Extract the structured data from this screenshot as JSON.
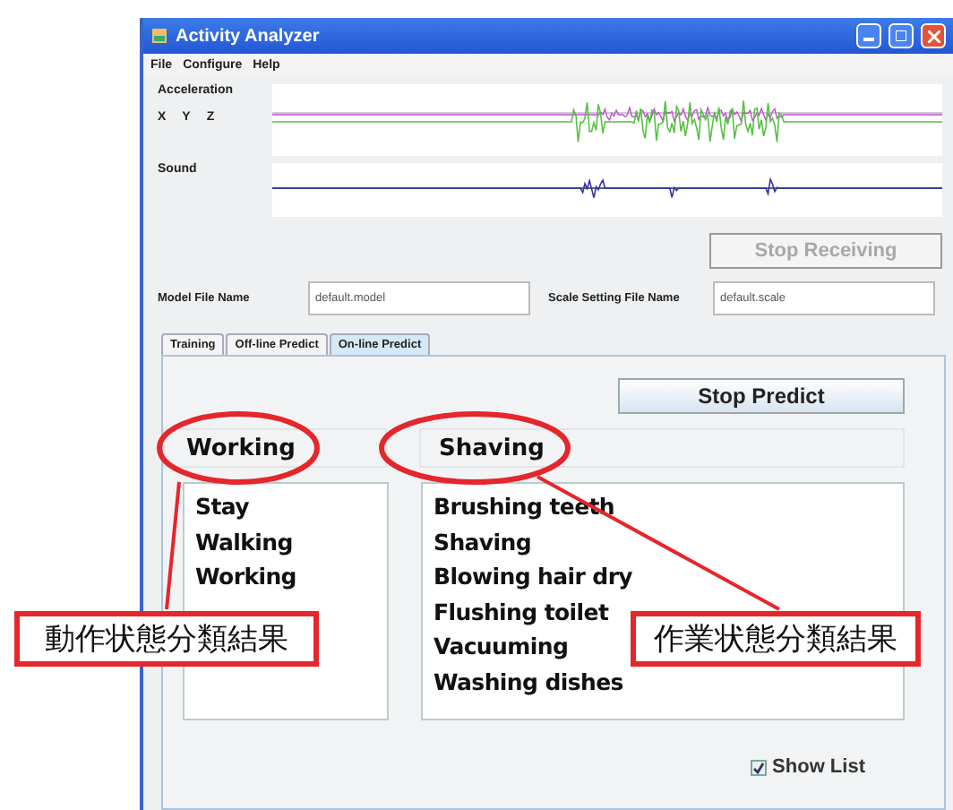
{
  "window": {
    "title": "Activity Analyzer"
  },
  "menu": [
    "File",
    "Configure",
    "Help"
  ],
  "signals": {
    "acceleration_label": "Acceleration",
    "axes": [
      "X",
      "Y",
      "Z"
    ],
    "sound_label": "Sound"
  },
  "stop_receiving": {
    "label": "Stop Receiving",
    "disabled": true
  },
  "files": [
    {
      "label": "Model File Name",
      "value": "default.model"
    },
    {
      "label": "Scale Setting File Name",
      "value": "default.scale"
    }
  ],
  "tabs": [
    {
      "label": "Training",
      "selected": false
    },
    {
      "label": "Off-line Predict",
      "selected": false
    },
    {
      "label": "On-line Predict",
      "selected": true
    }
  ],
  "stop_predict": "Stop Predict",
  "motion": {
    "result": "Working",
    "items": [
      "Stay",
      "Walking",
      "Working"
    ]
  },
  "task": {
    "result": "Shaving",
    "items": [
      "Brushing teeth",
      "Shaving",
      "Blowing hair dry",
      "Flushing toilet",
      "Vacuuming",
      "Washing dishes"
    ]
  },
  "show_list": {
    "label": "Show List",
    "checked": true
  },
  "annotations": [
    {
      "text": "動作状態分類結果"
    },
    {
      "text": "作業状態分類結果"
    }
  ]
}
